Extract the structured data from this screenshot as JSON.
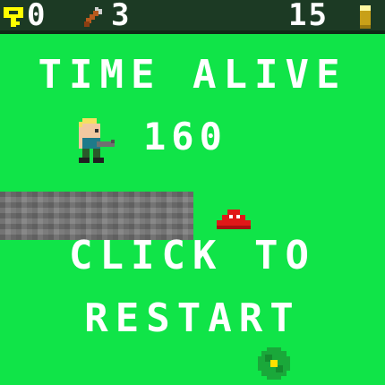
{
  "hud": {
    "keys": "0",
    "axes": "3",
    "ammo": "15",
    "icons": [
      "key-icon",
      "axe-icon",
      "bullet-icon"
    ],
    "colors": {
      "bar": "#1c3a24",
      "key": "#ffff00",
      "text": "#ffffff"
    }
  },
  "screen": {
    "title": "TIME ALIVE",
    "time_value": "160",
    "restart_line1": "CLICK TO",
    "restart_line2": "RESTART",
    "background": "#10e448"
  },
  "sprites": [
    "player-character",
    "stone-wall",
    "red-slime-enemy",
    "bush-flower"
  ]
}
